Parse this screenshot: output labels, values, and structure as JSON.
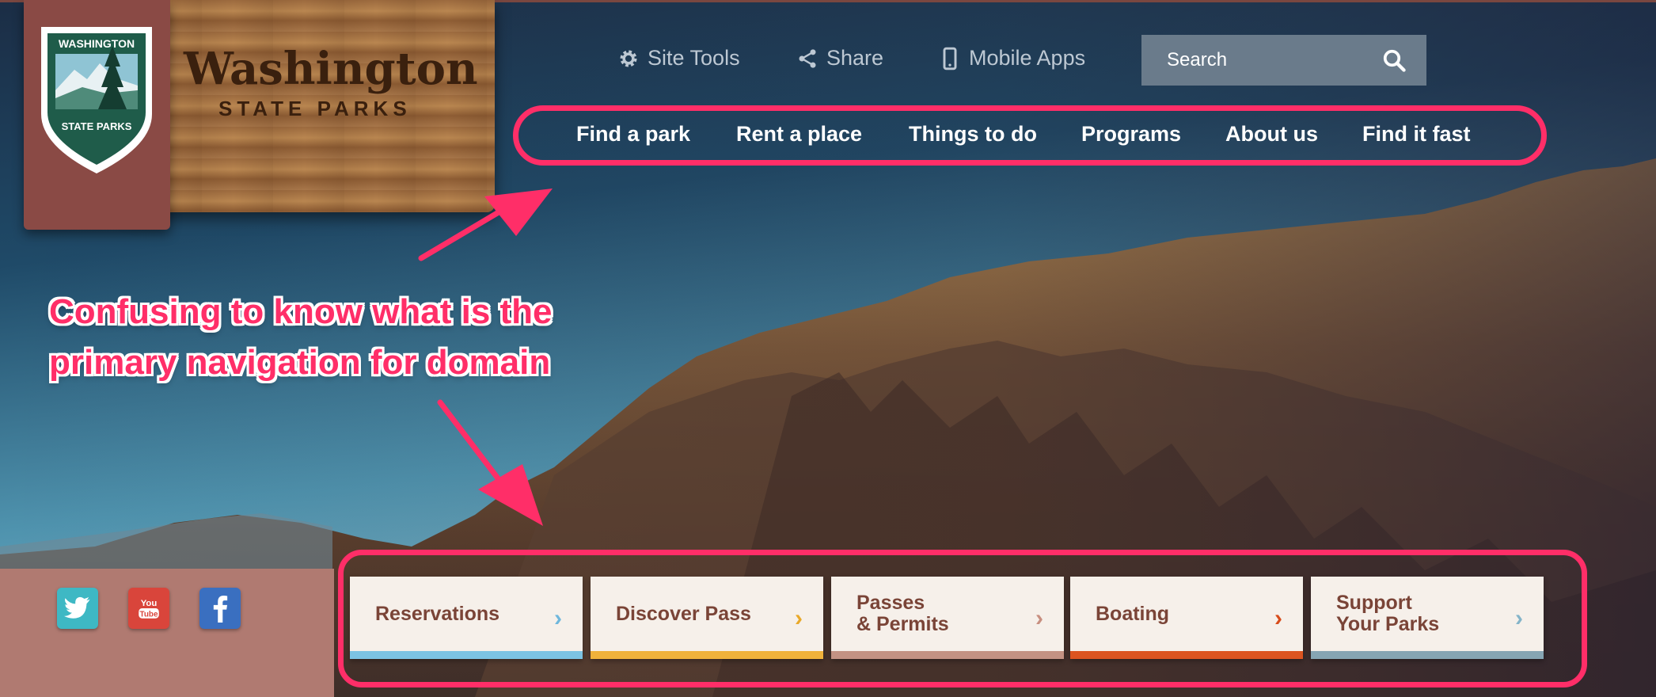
{
  "logo": {
    "badge_top_text": "WASHINGTON",
    "badge_bottom_text": "STATE PARKS",
    "title": "Washington",
    "subtitle": "STATE PARKS"
  },
  "utility_nav": {
    "site_tools": "Site Tools",
    "share": "Share",
    "mobile_apps": "Mobile Apps"
  },
  "search": {
    "placeholder": "Search"
  },
  "main_nav": [
    {
      "label": "Find a park"
    },
    {
      "label": "Rent a place"
    },
    {
      "label": "Things to do"
    },
    {
      "label": "Programs"
    },
    {
      "label": "About us"
    },
    {
      "label": "Find it fast"
    }
  ],
  "annotation": {
    "line1": "Confusing to know what is the",
    "line2": "primary navigation for domain"
  },
  "social": [
    "twitter-icon",
    "youtube-icon",
    "facebook-icon"
  ],
  "quick_links": [
    {
      "label": "Reservations",
      "accent": "#7cc3e3",
      "chevron": "#6fb7dc"
    },
    {
      "label": "Discover Pass",
      "accent": "#f0b23b",
      "chevron": "#e9a92a"
    },
    {
      "label": "Passes\n& Permits",
      "accent": "#c39283",
      "chevron": "#c88f80"
    },
    {
      "label": "Boating",
      "accent": "#dc5420",
      "chevron": "#d84c1b"
    },
    {
      "label": "Support\nYour Parks",
      "accent": "#86a5b3",
      "chevron": "#84b4c9"
    }
  ],
  "colors": {
    "annotation_accent": "#ff2e68",
    "social_bar": "#b07a71",
    "card_background": "#f6f0ea",
    "card_text": "#7a4437"
  }
}
